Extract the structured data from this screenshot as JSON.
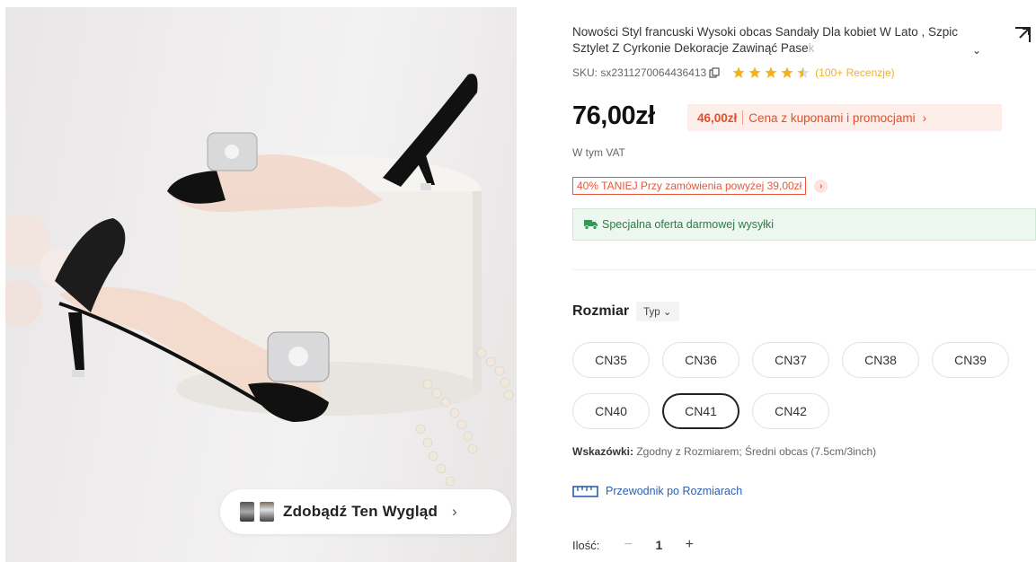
{
  "product_image": {
    "alt": "",
    "look_button": {
      "label": "Zdobądź Ten Wygląd",
      "chevron": "chevron-right-icon"
    }
  },
  "product": {
    "title_main": "Nowości Styl francuski Wysoki obcas Sandały Dla kobiet W Lato , Szpic Sztylet Z Cyrkonie Dekoracje Zawinąć Pase",
    "title_fade": "k",
    "sku": "SKU: sx2311270064436413",
    "rating_stars": 4.5,
    "reviews": "(100+ Recenzje)",
    "price": "76,00zł",
    "coupon_price": "46,00zł",
    "coupon_text": "Cena z kuponami i promocjami",
    "vat": "W tym VAT",
    "promo_tag": "40% TANIEJ Przy zamówienia powyżej 39,00zł",
    "shipping": "Specjalna oferta darmowej wysyłki"
  },
  "size_selector": {
    "title": "Rozmiar",
    "type_label": "Typ",
    "options": [
      "CN35",
      "CN36",
      "CN37",
      "CN38",
      "CN39",
      "CN40",
      "CN41",
      "CN42"
    ],
    "selected": "CN41"
  },
  "hints": {
    "label": "Wskazówki:",
    "text": " Zgodny z Rozmiarem; Średni obcas (7.5cm/3inch)"
  },
  "size_guide": {
    "label": "Przewodnik po Rozmiarach"
  },
  "quantity": {
    "label": "Ilość:",
    "minus": "−",
    "value": "1",
    "plus": "+"
  },
  "colors": {
    "accent_red": "#e54d2a",
    "coupon_bg": "#fdeeea",
    "shipping_green": "#2f7a44",
    "star_yellow": "#f4b11e",
    "link_blue": "#2b5fb3"
  }
}
